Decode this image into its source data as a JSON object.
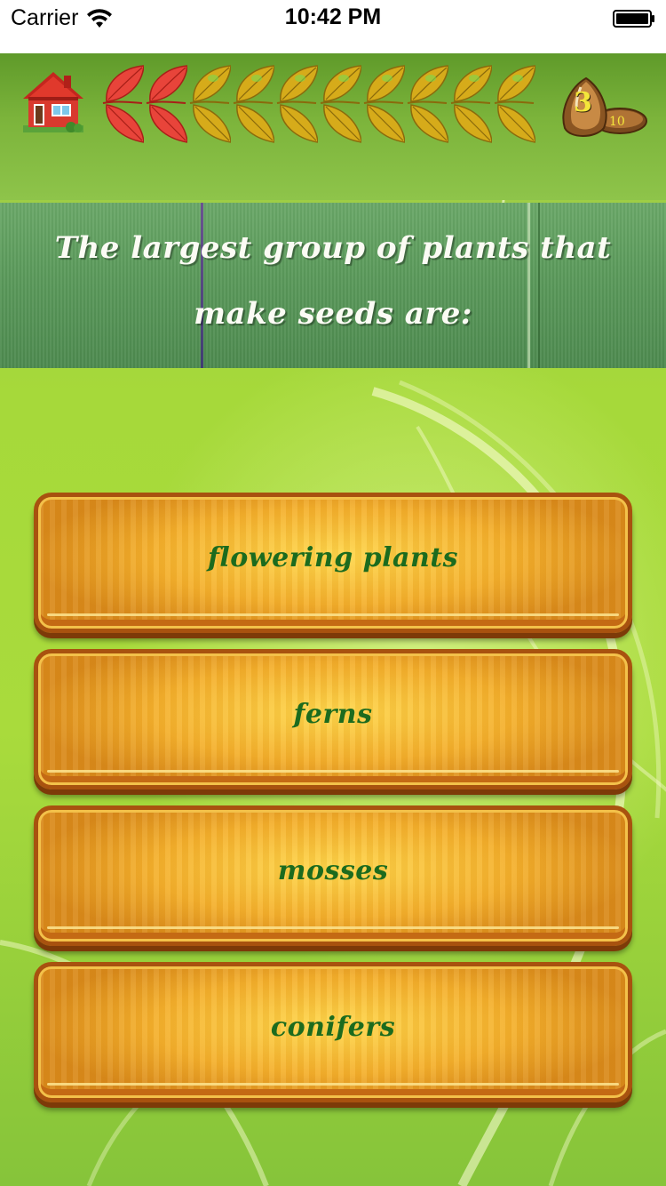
{
  "status_bar": {
    "carrier": "Carrier",
    "time": "10:42 PM",
    "wifi_icon": "wifi-icon",
    "battery_icon": "battery-full-icon"
  },
  "hud": {
    "home_icon": "house-icon",
    "progress": {
      "total": 10,
      "completed": 2,
      "completed_color": "#e8443a",
      "remaining_color": "#d6ab1a"
    },
    "seed_counter": {
      "icon": "seed-icon",
      "current": "3",
      "total": "10"
    }
  },
  "question": {
    "line1": "The largest group of plants that",
    "line2": "make seeds are:"
  },
  "answers": [
    {
      "label": "flowering plants"
    },
    {
      "label": "ferns"
    },
    {
      "label": "mosses"
    },
    {
      "label": "conifers"
    }
  ],
  "colors": {
    "answer_text": "#1c6b1e",
    "question_text": "#fbfbf4",
    "background_green": "#a6d93a"
  }
}
